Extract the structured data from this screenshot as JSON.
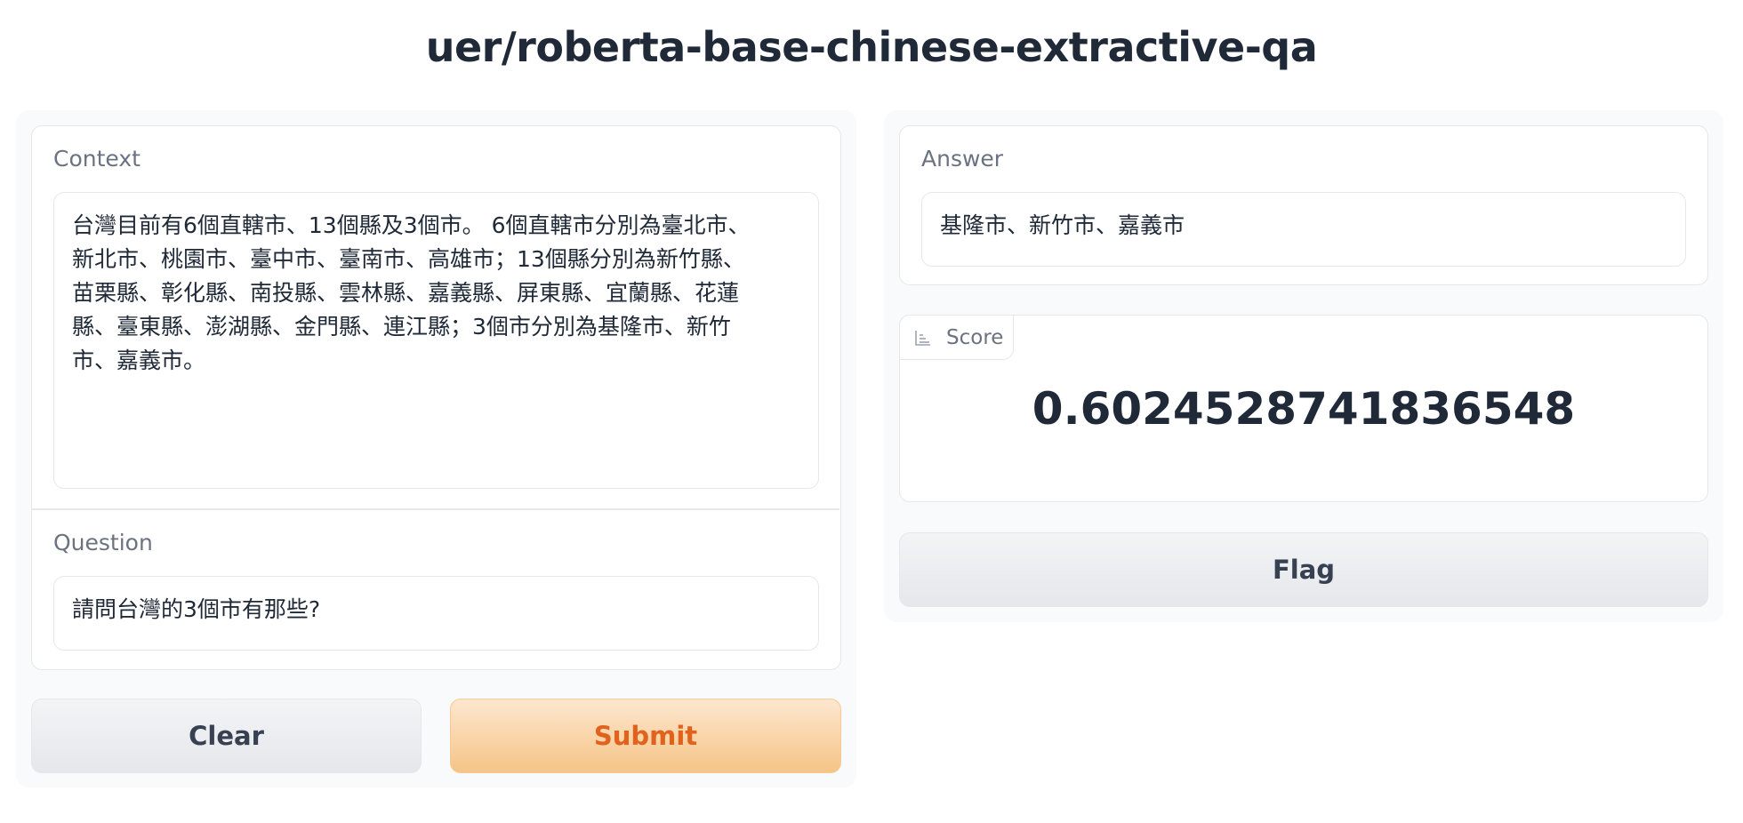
{
  "app": {
    "title": "uer/roberta-base-chinese-extractive-qa"
  },
  "inputs": {
    "context_label": "Context",
    "context_lines": [
      "台灣目前有6個直轄市、13個縣及3個市。 6個直轄市分別為臺北市、",
      "新北市、桃園市、臺中市、臺南市、高雄市；13個縣分別為新竹縣、",
      "苗栗縣、彰化縣、南投縣、雲林縣、嘉義縣、屏東縣、宜蘭縣、花蓮",
      "縣、臺東縣、澎湖縣、金門縣、連江縣；3個市分別為基隆市、新竹",
      "市、嘉義市。"
    ],
    "question_label": "Question",
    "question_value": "請問台灣的3個市有那些?"
  },
  "actions": {
    "clear_label": "Clear",
    "submit_label": "Submit",
    "flag_label": "Flag"
  },
  "outputs": {
    "answer_label": "Answer",
    "answer_value": "基隆市、新竹市、嘉義市",
    "score_label": "Score",
    "score_value": "0.6024528741836548"
  },
  "icons": {
    "score_tab": "chart-icon"
  }
}
